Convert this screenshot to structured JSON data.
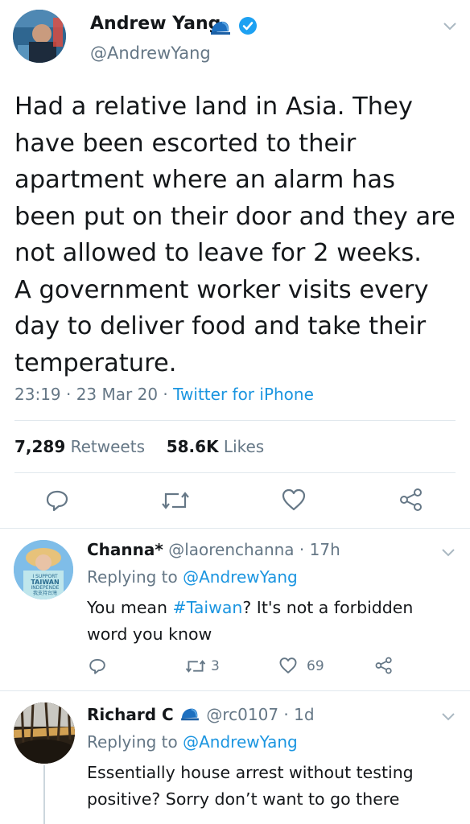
{
  "main_tweet": {
    "author_name": "Andrew Yang",
    "handle": "@AndrewYang",
    "text_lines": [
      "Had a relative land in Asia. They",
      "have been escorted to their",
      "apartment where an alarm has",
      "been put on their door and they are",
      "not allowed to leave for 2 weeks.",
      "A government worker visits every",
      "day to deliver food and take their",
      "temperature."
    ],
    "timestamp": "23:19 · 23 Mar 20 · ",
    "source": "Twitter for iPhone",
    "retweets_count": "7,289",
    "retweets_label": "Retweets",
    "likes_count": "58.6K",
    "likes_label": "Likes"
  },
  "replies": [
    {
      "name": "Channa*",
      "handle_time": "@laorenchanna · 17h",
      "replying_prefix": "Replying to ",
      "replying_to": "@AndrewYang",
      "text_before": "You mean ",
      "hashtag": "#Taiwan",
      "text_after": "? It's not a forbidden",
      "text_line2": "word you know",
      "retweet_count": "3",
      "like_count": "69",
      "avatar_lines": [
        "I SUPPORT",
        "TAIWAN",
        "INDEPENDE",
        "我支持台灣"
      ]
    },
    {
      "name": "Richard C",
      "handle_time": "@rc0107 · 1d",
      "replying_prefix": "Replying to ",
      "replying_to": "@AndrewYang",
      "text_line1": "Essentially house arrest without testing",
      "text_line2": "positive? Sorry don’t want to go there"
    }
  ],
  "icons": {
    "verified": "verified-badge-icon",
    "hat": "blue-cap-icon",
    "chevron": "chevron-down-icon",
    "reply": "reply-icon",
    "retweet": "retweet-icon",
    "like": "heart-icon",
    "share": "share-icon"
  },
  "colors": {
    "link": "#1b95e0",
    "muted": "#657786",
    "text": "#14171a",
    "divider": "#e1e8ed"
  }
}
